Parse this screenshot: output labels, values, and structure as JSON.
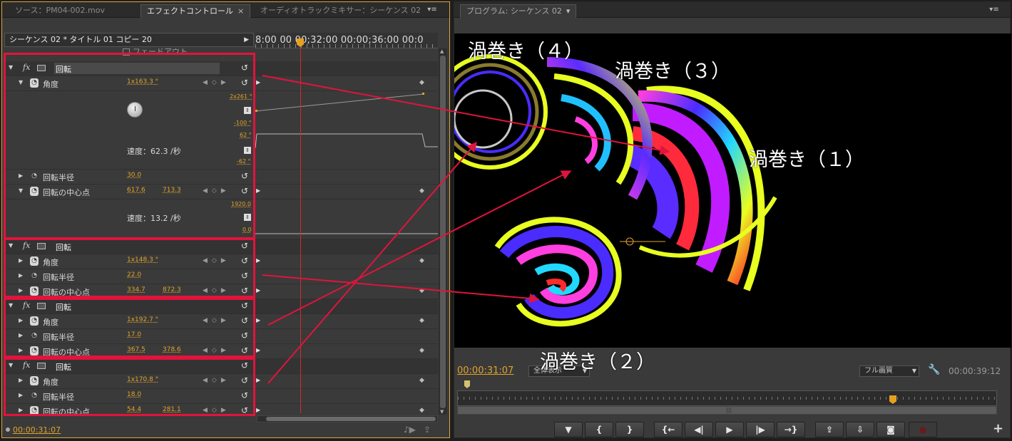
{
  "left_panel": {
    "tabs": [
      {
        "label": "ソース：PM04-002.mov"
      },
      {
        "label": "エフェクトコントロール",
        "close": "×"
      },
      {
        "label": "オーディオトラックミキサー：シーケンス 02"
      }
    ],
    "menu_icon": "▾≡",
    "sequence_header": "シーケンス 02 * タイトル 01 コピー 20",
    "header_arrow": "▶",
    "ruler_label": "8:00 00 00;32:00 00:00;36:00 00:0",
    "fade_label": "フェードアウト",
    "effects": [
      {
        "fx": "fx",
        "name": "回転",
        "angle": {
          "label": "角度",
          "value": "1x163.3 °",
          "graph_max": "2x261 °",
          "graph_min": "-100 °",
          "speed_max": "62 °",
          "speed_min": "-62 °",
          "speed_text": "速度：62.3 /秒"
        },
        "radius": {
          "label": "回転半径",
          "value": "30.0"
        },
        "center": {
          "label": "回転の中心点",
          "x": "617.6",
          "y": "713.3",
          "graph_max": "1920.0",
          "graph_min": "0.0",
          "speed_text": "速度：13.2 /秒"
        }
      },
      {
        "fx": "fx",
        "name": "回転",
        "angle": {
          "label": "角度",
          "value": "1x148.3 °"
        },
        "radius": {
          "label": "回転半径",
          "value": "22.0"
        },
        "center": {
          "label": "回転の中心点",
          "x": "334.7",
          "y": "872.3"
        }
      },
      {
        "fx": "fx",
        "name": "回転",
        "angle": {
          "label": "角度",
          "value": "1x192.7 °"
        },
        "radius": {
          "label": "回転半径",
          "value": "17.0"
        },
        "center": {
          "label": "回転の中心点",
          "x": "367.5",
          "y": "378.6"
        }
      },
      {
        "fx": "fx",
        "name": "回転",
        "angle": {
          "label": "角度",
          "value": "1x170.8 °"
        },
        "radius": {
          "label": "回転半径",
          "value": "18.0"
        },
        "center": {
          "label": "回転の中心点",
          "x": "54.4",
          "y": "281.1"
        }
      }
    ],
    "footer_time": "00:00:31:07"
  },
  "program": {
    "tab_label": "プログラム: シーケンス 02",
    "menu_icon": "▾≡",
    "timecode": "00:00:31:07",
    "zoom_value": "全体表示",
    "quality_value": "フル画質",
    "duration": "00:00:39:12",
    "labels": {
      "swirl_1": "渦巻き（１）",
      "swirl_2": "渦巻き（２）",
      "swirl_3": "渦巻き（３）",
      "swirl_4": "渦巻き（４）"
    },
    "transport": [
      "▼",
      "{",
      "}",
      "{←",
      "◀|",
      "▶",
      "|▶",
      "→}",
      "⇪",
      "⇩",
      "◙",
      "●"
    ],
    "add_label": "+"
  },
  "colors": {
    "accent": "#e0a32a",
    "annotation": "#e0143c",
    "playhead": "#d42a2a"
  }
}
